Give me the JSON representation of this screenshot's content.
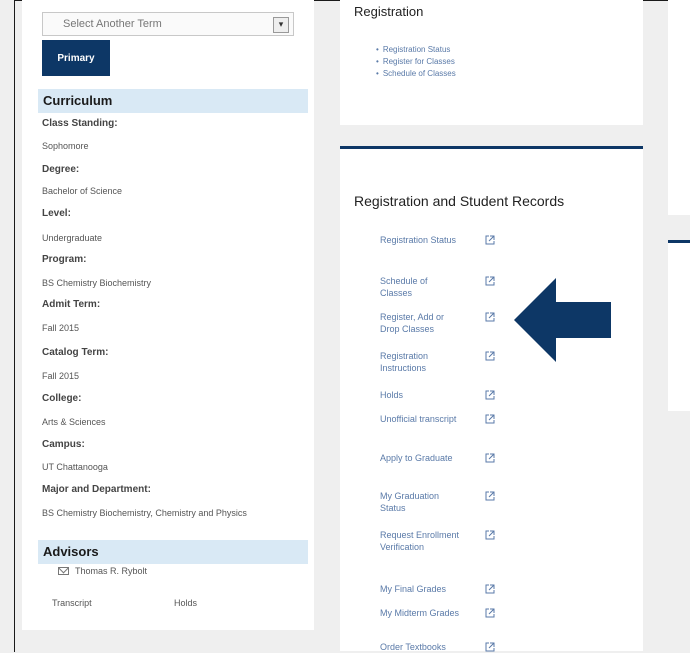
{
  "left": {
    "term_select": "Select Another Term",
    "tab_primary": "Primary",
    "curriculum_header": "Curriculum",
    "fields": [
      {
        "label": "Class Standing:",
        "value": "Sophomore"
      },
      {
        "label": "Degree:",
        "value": "Bachelor of Science"
      },
      {
        "label": "Level:",
        "value": "Undergraduate"
      },
      {
        "label": "Program:",
        "value": "BS Chemistry Biochemistry"
      },
      {
        "label": "Admit Term:",
        "value": "Fall 2015"
      },
      {
        "label": "Catalog Term:",
        "value": "Fall 2015"
      },
      {
        "label": "College:",
        "value": "Arts & Sciences"
      },
      {
        "label": "Campus:",
        "value": "UT Chattanooga"
      },
      {
        "label": "Major and Department:",
        "value": "BS Chemistry Biochemistry, Chemistry and Physics"
      }
    ],
    "advisors_header": "Advisors",
    "advisor": "Thomas R. Rybolt",
    "transcript_link": "Transcript",
    "holds_link": "Holds"
  },
  "registration_card": {
    "title": "Registration",
    "links": [
      "Registration Status",
      "Register for Classes",
      "Schedule of Classes"
    ]
  },
  "records_card": {
    "title": "Registration and Student Records",
    "items": [
      "Registration Status",
      "Schedule of Classes",
      "Register, Add or Drop Classes",
      "Registration Instructions",
      "Holds",
      "Unofficial transcript",
      "Apply to Graduate",
      "My Graduation Status",
      "Request Enrollment Verification",
      "My Final Grades",
      "My Midterm Grades",
      "Order Textbooks"
    ]
  },
  "colors": {
    "navy": "#0d3766",
    "header_bg": "#d9e9f5",
    "link": "#5a7aa8"
  },
  "icons": {
    "external_link": "external-link-icon",
    "arrow": "left-arrow-icon"
  }
}
